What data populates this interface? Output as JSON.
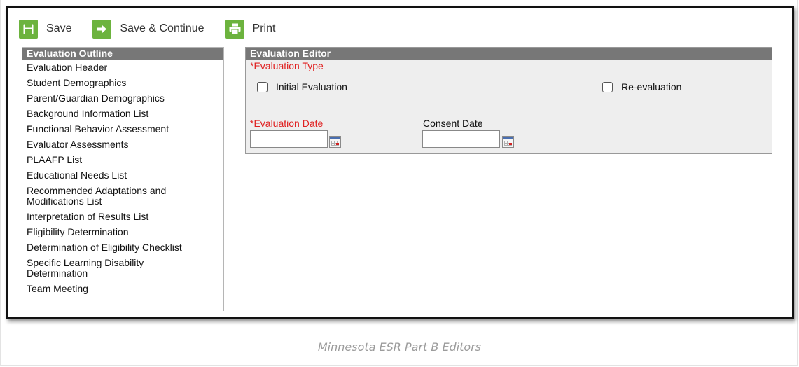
{
  "toolbar": {
    "save_label": "Save",
    "save_continue_label": "Save & Continue",
    "print_label": "Print",
    "accent_color": "#6cb33e"
  },
  "outline": {
    "header": "Evaluation Outline",
    "items": [
      "Evaluation Header",
      "Student Demographics",
      "Parent/Guardian Demographics",
      "Background Information List",
      "Functional Behavior Assessment",
      "Evaluator Assessments",
      "PLAAFP List",
      "Educational Needs List",
      "Recommended Adaptations and Modifications List",
      "Interpretation of Results List",
      "Eligibility Determination",
      "Determination of Eligibility Checklist",
      "Specific Learning Disability Determination",
      "Team Meeting"
    ]
  },
  "editor": {
    "header": "Evaluation Editor",
    "evaluation_type_label": "*Evaluation Type",
    "initial_evaluation_label": "Initial Evaluation",
    "initial_evaluation_checked": false,
    "re_evaluation_label": "Re-evaluation",
    "re_evaluation_checked": false,
    "evaluation_date_label": "*Evaluation Date",
    "evaluation_date_value": "",
    "consent_date_label": "Consent Date",
    "consent_date_value": ""
  },
  "caption": "Minnesota ESR Part B Editors"
}
